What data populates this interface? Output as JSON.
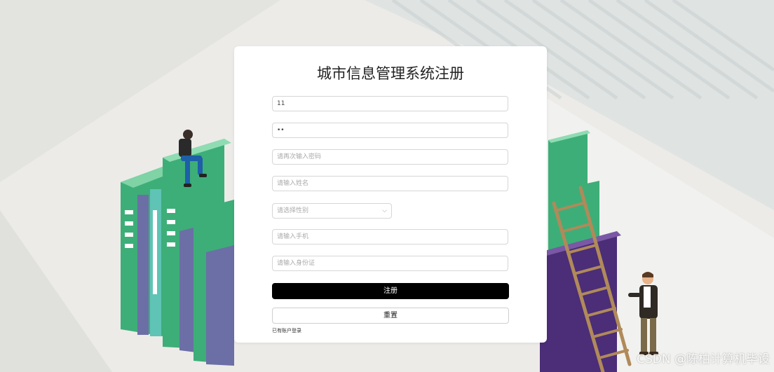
{
  "form": {
    "title": "城市信息管理系统注册",
    "username_value": "11",
    "password_value": "••",
    "confirm_placeholder": "请再次输入密码",
    "name_placeholder": "请输入姓名",
    "gender_placeholder": "请选择性别",
    "phone_placeholder": "请输入手机",
    "idcard_placeholder": "请输入身份证",
    "register_label": "注册",
    "reset_label": "重置",
    "login_link": "已有账户登录"
  },
  "watermark": "CSDN @陈柏计算机毕设",
  "colors": {
    "book_green": "#3dae78",
    "book_purple": "#6b6fa6",
    "book_teal": "#5fc4b5",
    "primary_button": "#000000"
  }
}
